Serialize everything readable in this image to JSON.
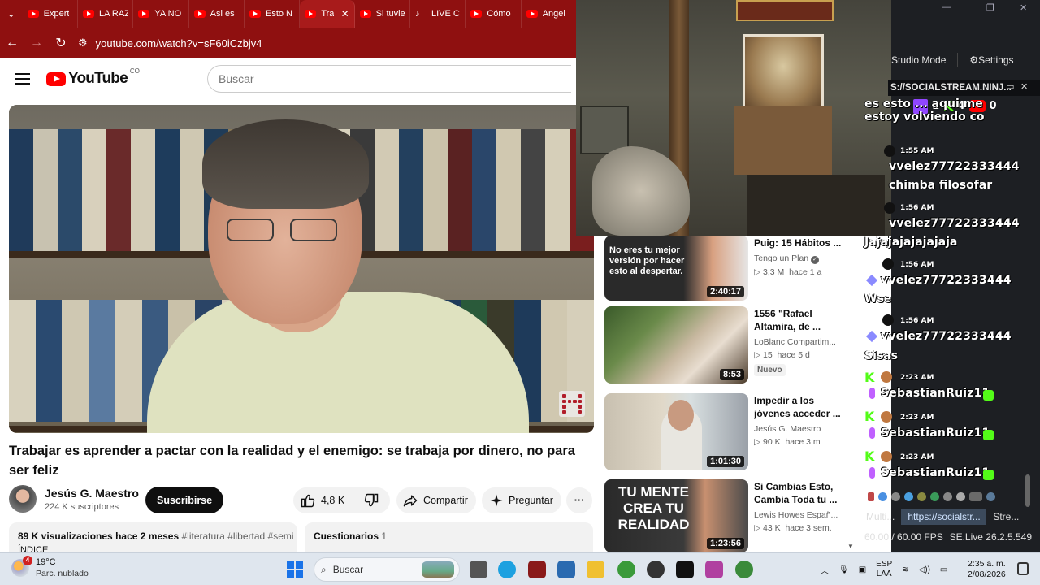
{
  "browser": {
    "tabs": [
      {
        "label": "Expert",
        "icon": "youtube"
      },
      {
        "label": "LA RAZ",
        "icon": "youtube"
      },
      {
        "label": "YA NO",
        "icon": "youtube"
      },
      {
        "label": "Asi es",
        "icon": "youtube"
      },
      {
        "label": "Esto N",
        "icon": "youtube"
      },
      {
        "label": "Tra",
        "icon": "youtube",
        "active": true
      },
      {
        "label": "Si tuvie",
        "icon": "youtube"
      },
      {
        "label": "LIVE C",
        "icon": "tiktok"
      },
      {
        "label": "Cómo",
        "icon": "youtube"
      },
      {
        "label": "Angel",
        "icon": "youtube"
      }
    ],
    "url": "youtube.com/watch?v=sF60iCzbjv4"
  },
  "youtube": {
    "logo_text": "YouTube",
    "country_code": "CO",
    "search_placeholder": "Buscar",
    "video": {
      "title": "Trabajar es aprender a pactar con la realidad y el enemigo: se trabaja por dinero, no para ser feliz",
      "channel_name": "Jesús G. Maestro",
      "subscribers": "224 K suscriptores",
      "subscribe_label": "Suscribirse",
      "likes": "4,8 K",
      "share_label": "Compartir",
      "ask_label": "Preguntar",
      "more_label": "···",
      "views": "89 K visualizaciones",
      "age": "hace 2 meses",
      "tags": "#literatura #libertad #semi",
      "index_label": "ÍNDICE",
      "quizzes_label": "Cuestionarios",
      "quizzes_count": "1"
    },
    "recommendations": [
      {
        "title": "Puig: 15 Hábitos ...",
        "channel": "Tengo un Plan",
        "views": "3,3 M",
        "age": "hace 1 a",
        "duration": "2:40:17",
        "thumb_text": "No eres tu mejor versión por hacer esto al despertar."
      },
      {
        "title": "1556 \"Rafael Altamira, de ...",
        "channel": "LoBlanc Compartim...",
        "views": "15",
        "age": "hace 5 d",
        "duration": "8:53",
        "badge": "Nuevo"
      },
      {
        "title": "Impedir a los jóvenes acceder ...",
        "channel": "Jesús G. Maestro",
        "views": "90 K",
        "age": "hace 3 m",
        "duration": "1:01:30"
      },
      {
        "title": "Si Cambias Esto, Cambia Toda tu ...",
        "channel": "Lewis Howes Españ...",
        "views": "43 K",
        "age": "hace 3 sem.",
        "duration": "1:23:56",
        "thumb_text": "TU MENTE CREA TU REALIDAD"
      }
    ]
  },
  "obs": {
    "menu": {
      "studio_mode": "Studio Mode",
      "settings": "Settings"
    },
    "dock_title": "S://SOCIALSTREAM.NINJ...",
    "counts": {
      "twitch": "1",
      "kick": "4",
      "youtube": "0"
    },
    "chat_top_text": "es esto ... aqui me estoy volviendo co",
    "messages": [
      {
        "time": "1:55 AM",
        "user": "vvelez77722333444",
        "text": "chimba filosofar"
      },
      {
        "time": "1:56 AM",
        "user": "vvelez77722333444",
        "text": "Jajajajajajajaja"
      },
      {
        "time": "1:56 AM",
        "user": "vvelez77722333444",
        "text": "Wse"
      },
      {
        "time": "1:56 AM",
        "user": "vvelez77722333444",
        "text": "Sisas"
      },
      {
        "time": "2:23 AM",
        "user": "SebastianRuiz11"
      },
      {
        "time": "2:23 AM",
        "user": "SebastianRuiz11"
      },
      {
        "time": "2:23 AM",
        "user": "SebastianRuiz11"
      }
    ],
    "dock_tabs": [
      "Multi...",
      "https://socialstr...",
      "Stre..."
    ],
    "fps": "60.00 / 60.00 FPS",
    "version": "SE.Live 26.2.5.549"
  },
  "taskbar": {
    "weather_temp": "19°C",
    "weather_desc": "Parc. nublado",
    "weather_badge": "4",
    "search_label": "Buscar",
    "lang_top": "ESP",
    "lang_bottom": "LAA",
    "time": "2:35 a. m.",
    "date": "2/08/2026"
  }
}
